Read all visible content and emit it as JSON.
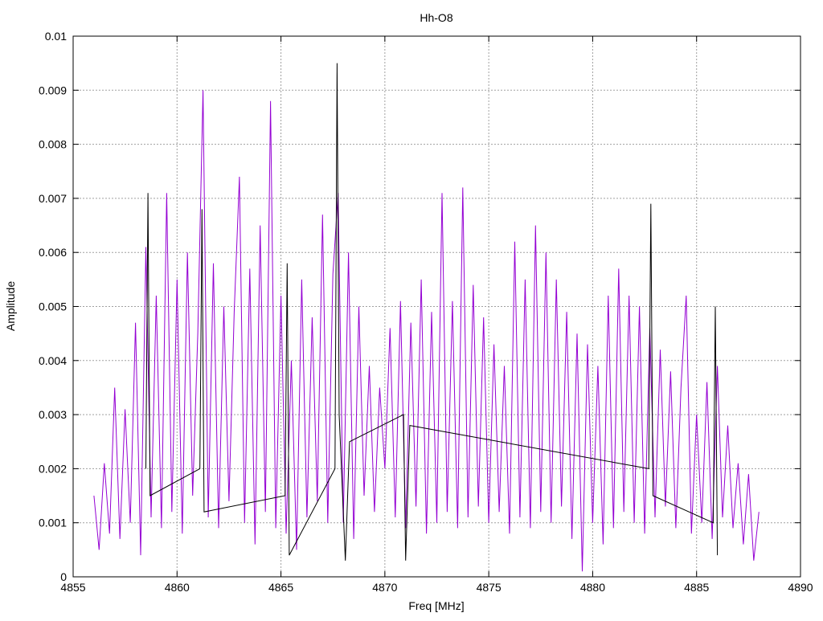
{
  "chart_data": {
    "type": "line",
    "title": "Hh-O8",
    "xlabel": "Freq [MHz]",
    "ylabel": "Amplitude",
    "xlim": [
      4855,
      4890
    ],
    "ylim": [
      0,
      0.01
    ],
    "grid": true,
    "xticks": [
      "4855",
      "4860",
      "4865",
      "4870",
      "4875",
      "4880",
      "4885",
      "4890"
    ],
    "yticks": [
      "0",
      "0.001",
      "0.002",
      "0.003",
      "0.004",
      "0.005",
      "0.006",
      "0.007",
      "0.008",
      "0.009",
      "0.01"
    ],
    "series": [
      {
        "name": "purple",
        "color": "#9400d3",
        "x_start": 4856,
        "x_step": 0.25,
        "values": [
          0.0015,
          0.0005,
          0.0021,
          0.0008,
          0.0035,
          0.0007,
          0.0031,
          0.001,
          0.0047,
          0.0004,
          0.0061,
          0.0011,
          0.0052,
          0.0009,
          0.0071,
          0.0012,
          0.0055,
          0.0008,
          0.006,
          0.0015,
          0.0045,
          0.009,
          0.0011,
          0.0058,
          0.0009,
          0.005,
          0.0014,
          0.0049,
          0.0074,
          0.001,
          0.0057,
          0.0006,
          0.0065,
          0.0012,
          0.0088,
          0.0009,
          0.0052,
          0.0008,
          0.004,
          0.0005,
          0.0055,
          0.0011,
          0.0048,
          0.0014,
          0.0067,
          0.001,
          0.0056,
          0.0071,
          0.001,
          0.006,
          0.0007,
          0.005,
          0.0015,
          0.0039,
          0.0012,
          0.0035,
          0.002,
          0.0046,
          0.0011,
          0.0051,
          0.0009,
          0.0047,
          0.0013,
          0.0055,
          0.0008,
          0.0049,
          0.001,
          0.0071,
          0.0012,
          0.0051,
          0.0009,
          0.0072,
          0.0011,
          0.0054,
          0.0013,
          0.0048,
          0.001,
          0.0043,
          0.0012,
          0.0039,
          0.0008,
          0.0062,
          0.0011,
          0.0055,
          0.0009,
          0.0065,
          0.0012,
          0.006,
          0.001,
          0.0055,
          0.0013,
          0.0049,
          0.0007,
          0.0045,
          0.0001,
          0.0043,
          0.001,
          0.0039,
          0.0006,
          0.0052,
          0.0009,
          0.0057,
          0.0012,
          0.0052,
          0.001,
          0.005,
          0.0008,
          0.0046,
          0.0011,
          0.0042,
          0.0013,
          0.0038,
          0.0009,
          0.0035,
          0.0052,
          0.0008,
          0.003,
          0.001,
          0.0036,
          0.0007,
          0.0039,
          0.0011,
          0.0028,
          0.0009,
          0.0021,
          0.0006,
          0.0019,
          0.0003,
          0.0012
        ]
      },
      {
        "name": "black",
        "color": "#000000",
        "points": [
          [
            4858.5,
            0.002
          ],
          [
            4858.6,
            0.0071
          ],
          [
            4858.7,
            0.0015
          ],
          [
            4861.1,
            0.002
          ],
          [
            4861.2,
            0.0068
          ],
          [
            4861.3,
            0.0012
          ],
          [
            4865.2,
            0.0015
          ],
          [
            4865.3,
            0.0058
          ],
          [
            4865.4,
            0.0004
          ],
          [
            4867.6,
            0.002
          ],
          [
            4867.7,
            0.0095
          ],
          [
            4867.8,
            0.003
          ],
          [
            4868.1,
            0.0003
          ],
          [
            4868.3,
            0.0025
          ],
          [
            4870.9,
            0.003
          ],
          [
            4871.0,
            0.0003
          ],
          [
            4871.2,
            0.0028
          ],
          [
            4882.7,
            0.002
          ],
          [
            4882.8,
            0.0069
          ],
          [
            4882.9,
            0.0015
          ],
          [
            4885.8,
            0.001
          ],
          [
            4885.9,
            0.005
          ],
          [
            4886.0,
            0.0004
          ]
        ]
      }
    ]
  }
}
